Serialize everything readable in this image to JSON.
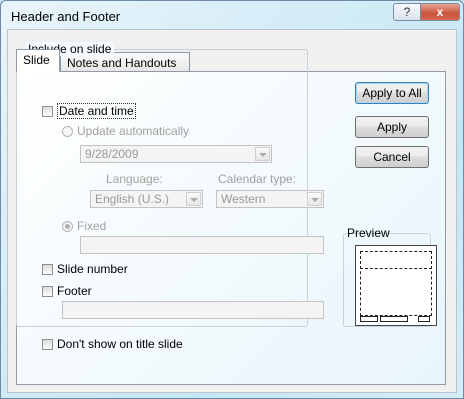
{
  "window": {
    "title": "Header and Footer",
    "help_glyph": "?",
    "close_glyph": "x"
  },
  "tabs": [
    {
      "label": "Slide",
      "selected": true
    },
    {
      "label": "Notes and Handouts",
      "selected": false
    }
  ],
  "include": {
    "group_label": "Include on slide",
    "date_time": {
      "label": "Date and time",
      "checked": false
    },
    "update_auto": {
      "label": "Update automatically",
      "selected": false
    },
    "date_value": "9/28/2009",
    "language": {
      "label": "Language:",
      "value": "English (U.S.)"
    },
    "calendar": {
      "label": "Calendar type:",
      "value": "Western"
    },
    "fixed": {
      "label": "Fixed",
      "selected": true
    },
    "fixed_value": "",
    "slide_number": {
      "label": "Slide number",
      "checked": false
    },
    "footer": {
      "label": "Footer",
      "checked": false
    },
    "footer_value": ""
  },
  "dont_show": {
    "label": "Don't show on title slide",
    "checked": false
  },
  "buttons": {
    "apply_all": "Apply to All",
    "apply": "Apply",
    "cancel": "Cancel"
  },
  "preview": {
    "label": "Preview"
  },
  "colors": {
    "accent": "#3c7fb1",
    "close": "#c9523a"
  }
}
